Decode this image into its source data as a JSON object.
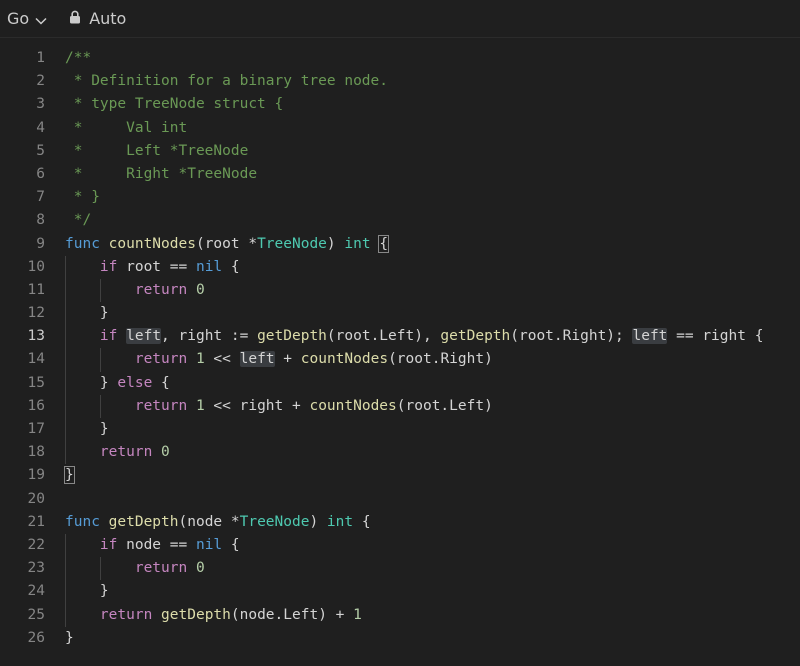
{
  "toolbar": {
    "language": "Go",
    "language_icon": "chevron-down-icon",
    "mode_icon": "lock-icon",
    "mode": "Auto"
  },
  "editor": {
    "active_line": 13,
    "lines": [
      {
        "n": "1",
        "indent": 0,
        "tokens": [
          [
            "c",
            "/**"
          ]
        ]
      },
      {
        "n": "2",
        "indent": 0,
        "tokens": [
          [
            "c",
            " * Definition for a binary tree node."
          ]
        ]
      },
      {
        "n": "3",
        "indent": 0,
        "tokens": [
          [
            "c",
            " * type TreeNode struct {"
          ]
        ]
      },
      {
        "n": "4",
        "indent": 0,
        "tokens": [
          [
            "c",
            " *     Val int"
          ]
        ]
      },
      {
        "n": "5",
        "indent": 0,
        "tokens": [
          [
            "c",
            " *     Left *TreeNode"
          ]
        ]
      },
      {
        "n": "6",
        "indent": 0,
        "tokens": [
          [
            "c",
            " *     Right *TreeNode"
          ]
        ]
      },
      {
        "n": "7",
        "indent": 0,
        "tokens": [
          [
            "c",
            " * }"
          ]
        ]
      },
      {
        "n": "8",
        "indent": 0,
        "tokens": [
          [
            "c",
            " */"
          ]
        ]
      },
      {
        "n": "9",
        "indent": 0,
        "tokens": [
          [
            "k",
            "func"
          ],
          [
            "p",
            " "
          ],
          [
            "f",
            "countNodes"
          ],
          [
            "p",
            "(root *"
          ],
          [
            "t",
            "TreeNode"
          ],
          [
            "p",
            ") "
          ],
          [
            "t",
            "int"
          ],
          [
            "p",
            " "
          ],
          [
            "b",
            "{"
          ]
        ]
      },
      {
        "n": "10",
        "indent": 1,
        "tokens": [
          [
            "p",
            "    "
          ],
          [
            "x",
            "if"
          ],
          [
            "p",
            " root == "
          ],
          [
            "k",
            "nil"
          ],
          [
            "p",
            " {"
          ]
        ]
      },
      {
        "n": "11",
        "indent": 2,
        "tokens": [
          [
            "p",
            "        "
          ],
          [
            "x",
            "return"
          ],
          [
            "p",
            " "
          ],
          [
            "n",
            "0"
          ]
        ]
      },
      {
        "n": "12",
        "indent": 1,
        "tokens": [
          [
            "p",
            "    }"
          ]
        ]
      },
      {
        "n": "13",
        "indent": 1,
        "tokens": [
          [
            "p",
            "    "
          ],
          [
            "x",
            "if"
          ],
          [
            "p",
            " "
          ],
          [
            "h",
            "left"
          ],
          [
            "p",
            ", right := "
          ],
          [
            "f",
            "getDepth"
          ],
          [
            "p",
            "(root.Left), "
          ],
          [
            "f",
            "getDepth"
          ],
          [
            "p",
            "(root.Right); "
          ],
          [
            "h",
            "left"
          ],
          [
            "p",
            " == right {"
          ]
        ]
      },
      {
        "n": "14",
        "indent": 2,
        "tokens": [
          [
            "p",
            "        "
          ],
          [
            "x",
            "return"
          ],
          [
            "p",
            " "
          ],
          [
            "n",
            "1"
          ],
          [
            "p",
            " << "
          ],
          [
            "h",
            "left"
          ],
          [
            "p",
            " + "
          ],
          [
            "f",
            "countNodes"
          ],
          [
            "p",
            "(root.Right)"
          ]
        ]
      },
      {
        "n": "15",
        "indent": 1,
        "tokens": [
          [
            "p",
            "    } "
          ],
          [
            "x",
            "else"
          ],
          [
            "p",
            " {"
          ]
        ]
      },
      {
        "n": "16",
        "indent": 2,
        "tokens": [
          [
            "p",
            "        "
          ],
          [
            "x",
            "return"
          ],
          [
            "p",
            " "
          ],
          [
            "n",
            "1"
          ],
          [
            "p",
            " << right + "
          ],
          [
            "f",
            "countNodes"
          ],
          [
            "p",
            "(root.Left)"
          ]
        ]
      },
      {
        "n": "17",
        "indent": 1,
        "tokens": [
          [
            "p",
            "    }"
          ]
        ]
      },
      {
        "n": "18",
        "indent": 1,
        "tokens": [
          [
            "p",
            "    "
          ],
          [
            "x",
            "return"
          ],
          [
            "p",
            " "
          ],
          [
            "n",
            "0"
          ]
        ]
      },
      {
        "n": "19",
        "indent": 0,
        "tokens": [
          [
            "b",
            "}"
          ]
        ]
      },
      {
        "n": "20",
        "indent": 0,
        "tokens": [
          [
            "p",
            ""
          ]
        ]
      },
      {
        "n": "21",
        "indent": 0,
        "tokens": [
          [
            "k",
            "func"
          ],
          [
            "p",
            " "
          ],
          [
            "f",
            "getDepth"
          ],
          [
            "p",
            "(node *"
          ],
          [
            "t",
            "TreeNode"
          ],
          [
            "p",
            ") "
          ],
          [
            "t",
            "int"
          ],
          [
            "p",
            " {"
          ]
        ]
      },
      {
        "n": "22",
        "indent": 1,
        "tokens": [
          [
            "p",
            "    "
          ],
          [
            "x",
            "if"
          ],
          [
            "p",
            " node == "
          ],
          [
            "k",
            "nil"
          ],
          [
            "p",
            " {"
          ]
        ]
      },
      {
        "n": "23",
        "indent": 2,
        "tokens": [
          [
            "p",
            "        "
          ],
          [
            "x",
            "return"
          ],
          [
            "p",
            " "
          ],
          [
            "n",
            "0"
          ]
        ]
      },
      {
        "n": "24",
        "indent": 1,
        "tokens": [
          [
            "p",
            "    }"
          ]
        ]
      },
      {
        "n": "25",
        "indent": 1,
        "tokens": [
          [
            "p",
            "    "
          ],
          [
            "x",
            "return"
          ],
          [
            "p",
            " "
          ],
          [
            "f",
            "getDepth"
          ],
          [
            "p",
            "(node.Left) + "
          ],
          [
            "n",
            "1"
          ]
        ]
      },
      {
        "n": "26",
        "indent": 0,
        "tokens": [
          [
            "p",
            "}"
          ]
        ]
      }
    ]
  }
}
